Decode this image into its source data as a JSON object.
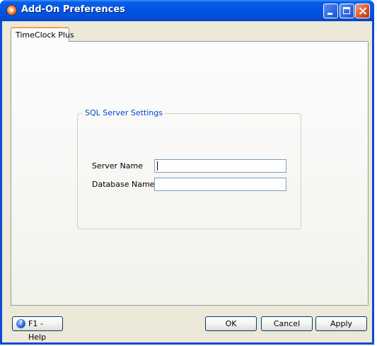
{
  "window": {
    "title": "Add-On Preferences",
    "accent_color": "#0054e3"
  },
  "tabs": [
    {
      "label": "TimeClock Plus",
      "active": true
    }
  ],
  "sql_settings": {
    "group_title": "SQL Server Settings",
    "server_name": {
      "label": "Server Name",
      "value": ""
    },
    "database_name": {
      "label": "Database Name",
      "value": ""
    }
  },
  "footer": {
    "help_label": "F1 - Help",
    "help_icon": "?",
    "ok_label": "OK",
    "cancel_label": "Cancel",
    "apply_label": "Apply"
  }
}
